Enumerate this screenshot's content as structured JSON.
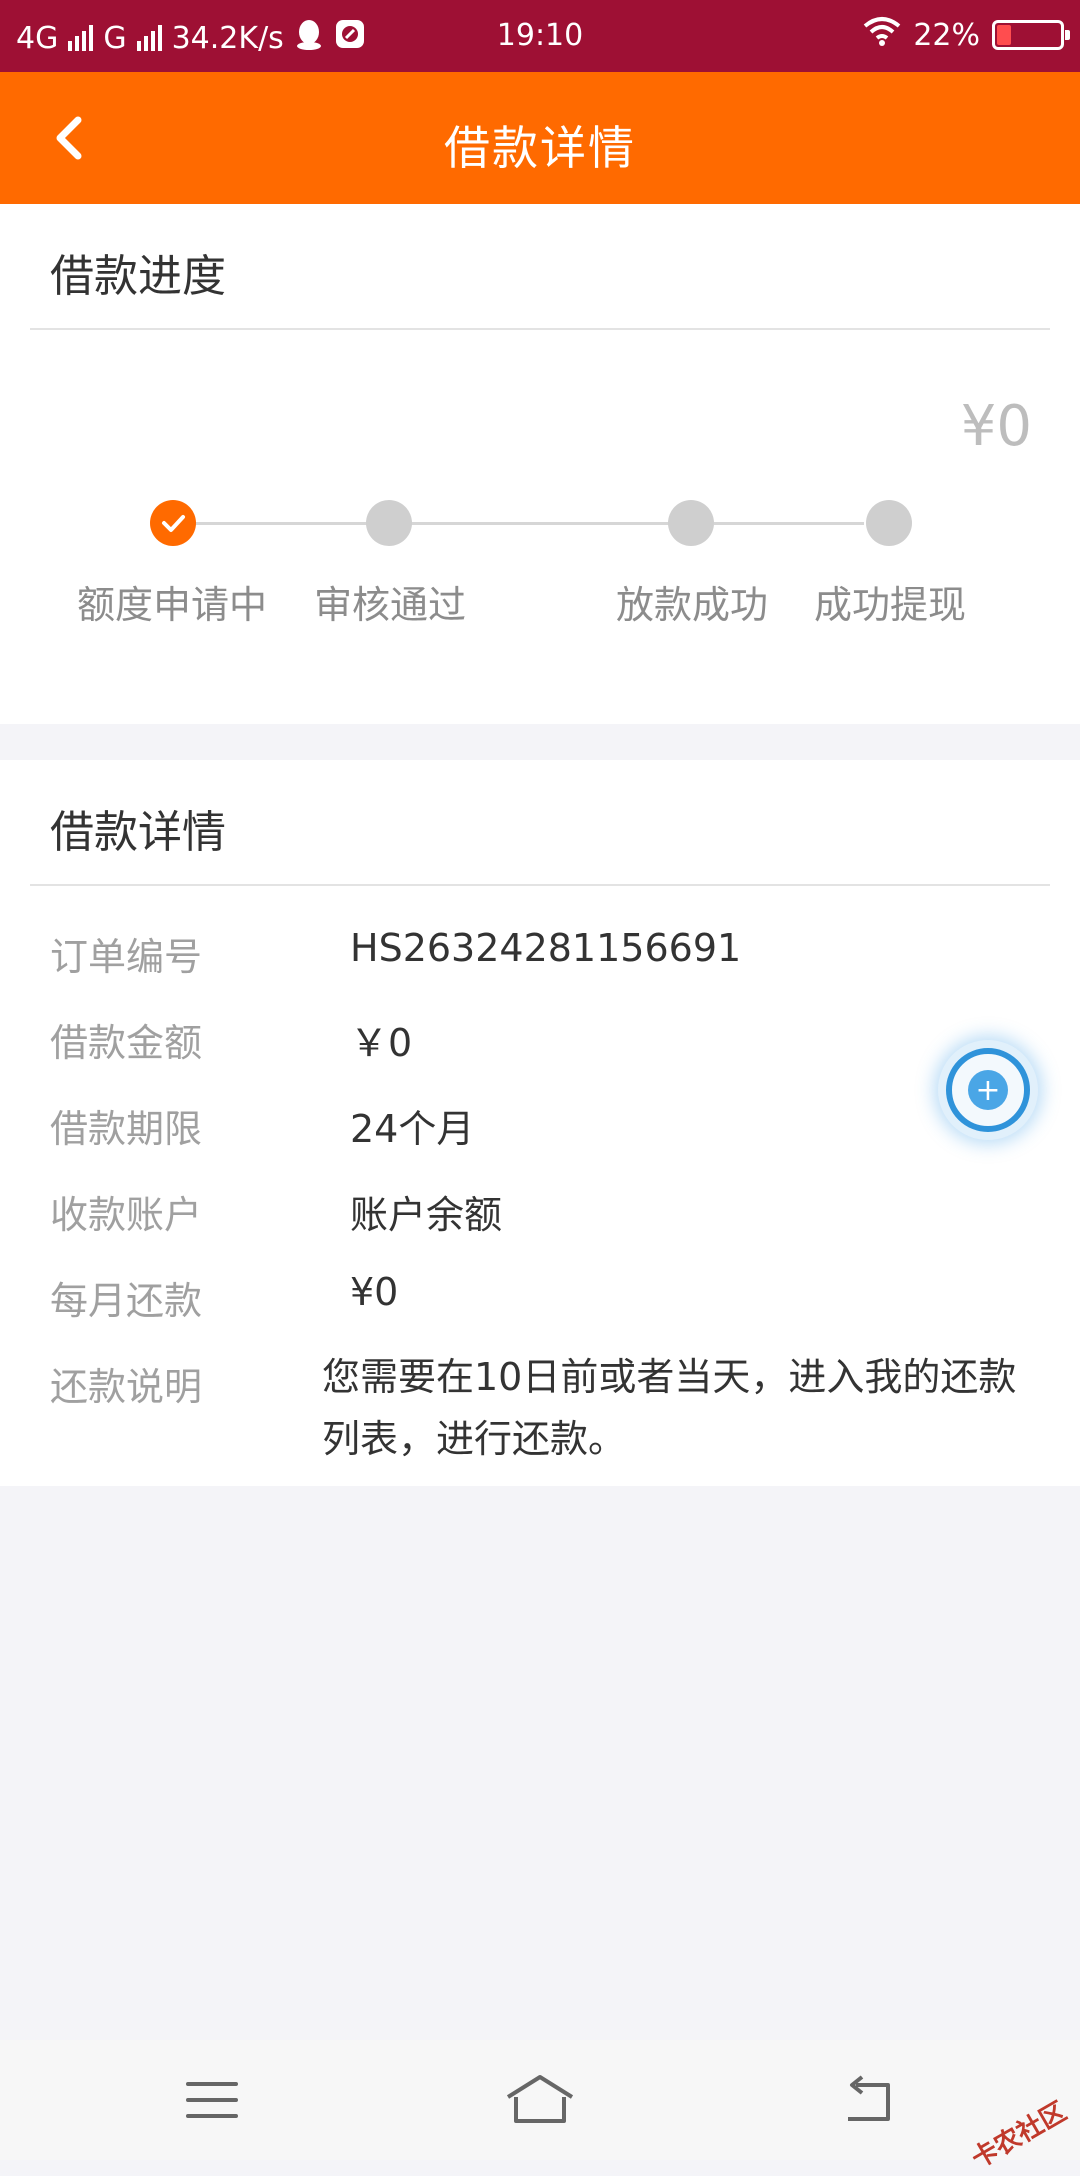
{
  "status_bar": {
    "network_1": "4G",
    "network_2": "G",
    "speed": "34.2K/s",
    "time": "19:10",
    "battery": "22%",
    "icons": [
      "qq-icon",
      "app-icon",
      "wifi-icon",
      "battery-icon"
    ]
  },
  "header": {
    "title": "借款详情",
    "back_icon": "chevron-left-icon",
    "color": "#ff6a00"
  },
  "progress": {
    "title": "借款进度",
    "amount": "¥0",
    "steps": [
      {
        "label": "额度申请中",
        "done": true
      },
      {
        "label": "审核通过",
        "done": false
      },
      {
        "label": "放款成功",
        "done": false
      },
      {
        "label": "成功提现",
        "done": false
      }
    ]
  },
  "details": {
    "title": "借款详情",
    "rows": [
      {
        "label": "订单编号",
        "value": "HS26324281156691"
      },
      {
        "label": "借款金额",
        "value": "￥0"
      },
      {
        "label": "借款期限",
        "value": "24个月"
      },
      {
        "label": "收款账户",
        "value": "账户余额"
      },
      {
        "label": "每月还款",
        "value": "¥0"
      },
      {
        "label": "还款说明",
        "value": "您需要在10日前或者当天，进入我的还款列表，进行还款。"
      }
    ]
  },
  "floating_button": {
    "icon": "plus-icon"
  },
  "nav_bar": {
    "icons": [
      "menu-icon",
      "home-icon",
      "back-icon"
    ]
  },
  "watermark": "卡农社区"
}
